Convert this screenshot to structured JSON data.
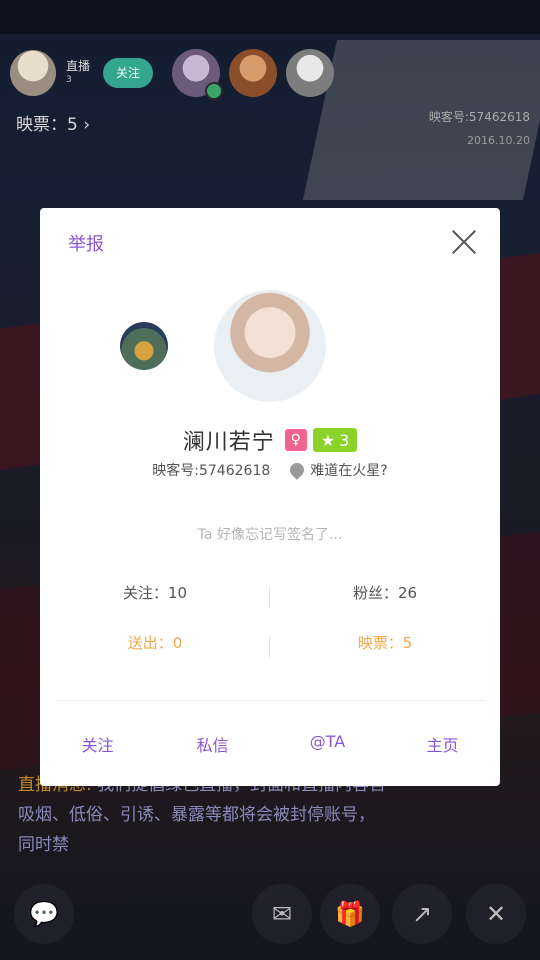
{
  "host": {
    "title": "直播",
    "sub": "3",
    "follow_label": "关注"
  },
  "tickets": "映票：5 ›",
  "room": {
    "id": "映客号:57462618",
    "date": "2016.10.20"
  },
  "notice": {
    "head": "直播消息:",
    "text": "我们提倡绿色直播，封面和直播内容含吸烟、低俗、引诱、暴露等都将会被封停账号，同时禁"
  },
  "modal": {
    "report_label": "举报",
    "name": "澜川若宁",
    "gender_symbol": "♀",
    "level": "3",
    "id_text": "映客号:57462618",
    "location": "难道在火星?",
    "signature": "Ta 好像忘记写签名了...",
    "stats": {
      "follow": "关注：10",
      "fans": "粉丝：26",
      "sent": "送出：0",
      "tickets": "映票：5"
    },
    "actions": [
      "关注",
      "私信",
      "@TA",
      "主页"
    ]
  },
  "icons": {
    "chat": "chat-bubble-icon",
    "message": "envelope-icon",
    "gift": "gift-icon",
    "share": "share-icon",
    "close": "close-icon"
  },
  "colors": {
    "accent": "#8856d6",
    "orange": "#f0a84a",
    "level_green": "#8bd32a",
    "gender_pink": "#f0658f",
    "follow_green": "#34a58f"
  }
}
